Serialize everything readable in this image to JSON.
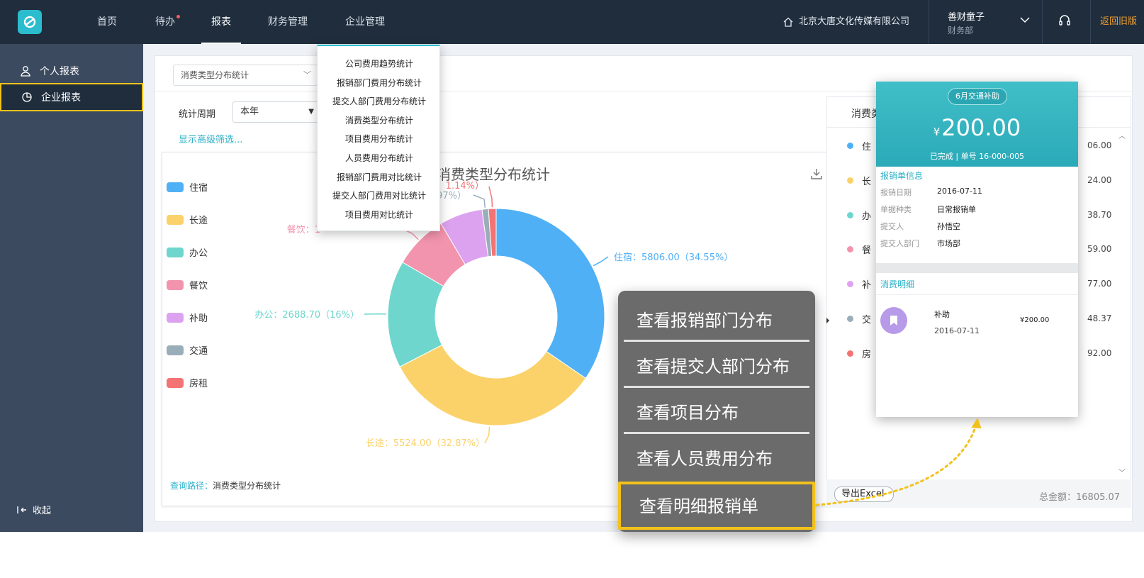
{
  "nav": {
    "items": [
      {
        "label": "首页"
      },
      {
        "label": "待办"
      },
      {
        "label": "报表"
      },
      {
        "label": "财务管理"
      },
      {
        "label": "企业管理"
      }
    ],
    "company": "北京大唐文化传媒有限公司",
    "user_name": "善财童子",
    "user_dept": "财务部",
    "back_old": "返回旧版",
    "icons": [
      "logo-icon",
      "home-icon",
      "chevron-down-icon",
      "headset-icon"
    ]
  },
  "sidebar": {
    "items": [
      {
        "label": "个人报表",
        "icon": "user-icon"
      },
      {
        "label": "企业报表",
        "icon": "pie-icon"
      }
    ],
    "collapse": "收起"
  },
  "filters": {
    "report_select": "消费类型分布统计",
    "period_label": "统计周期",
    "period_value": "本年",
    "advanced": "显示高级筛选..."
  },
  "dropdown": {
    "items": [
      "公司费用趋势统计",
      "报销部门费用分布统计",
      "提交人部门费用分布统计",
      "消费类型分布统计",
      "项目费用分布统计",
      "人员费用分布统计",
      "报销部门费用对比统计",
      "提交人部门费用对比统计",
      "项目费用对比统计"
    ]
  },
  "chart_data": {
    "type": "pie",
    "title": "消费类型分布统计",
    "donut": true,
    "categories": [
      "住宿",
      "长途",
      "办公",
      "餐饮",
      "补助",
      "交通",
      "房租"
    ],
    "values": [
      5806.0,
      5524.0,
      2688.7,
      1359.0,
      1077.0,
      158.37,
      192.0
    ],
    "percent_labels": [
      "34.55%",
      "32.87%",
      "16%",
      "",
      "",
      "",
      "1.14%"
    ],
    "colors": [
      "#4fb0f6",
      "#fbd26a",
      "#6ed6cc",
      "#f394ae",
      "#dda2ef",
      "#9aaeb9",
      "#f47374"
    ],
    "labels_visible": {
      "zhusu": "住宿：5806.00（34.55%）",
      "changtu": "长途：5524.00（32.87%）",
      "bangong": "办公：2688.70（16%）",
      "canyin_partial": "餐饮：1",
      "bu_partial": "97%）",
      "fangzu_partial": "1.14%）"
    },
    "legend_placement": "left"
  },
  "query_path": {
    "label": "查询路径：",
    "value": "消费类型分布统计"
  },
  "right_panel": {
    "header": "消费类",
    "rows": [
      {
        "label": "住",
        "amount": "06.00",
        "color": "#4fb0f6"
      },
      {
        "label": "长",
        "amount": "24.00",
        "color": "#fbd26a"
      },
      {
        "label": "办",
        "amount": "38.70",
        "color": "#6ed6cc"
      },
      {
        "label": "餐",
        "amount": "59.00",
        "color": "#f394ae"
      },
      {
        "label": "补",
        "amount": "77.00",
        "color": "#dda2ef"
      },
      {
        "label": "交",
        "amount": "48.37",
        "color": "#9aaeb9"
      },
      {
        "label": "房",
        "amount": "92.00",
        "color": "#f47374"
      }
    ],
    "export": "导出Excel",
    "total": "总金额：16805.07"
  },
  "detail_card": {
    "pill": "6月交通补助",
    "currency": "¥",
    "amount": "200.00",
    "status": "已完成 | 单号 16-000-005",
    "section1": "报销单信息",
    "fields": [
      {
        "label": "报销日期",
        "value": "2016-07-11"
      },
      {
        "label": "单据种类",
        "value": "日常报销单"
      },
      {
        "label": "提交人",
        "value": "孙悟空"
      },
      {
        "label": "提交人部门",
        "value": "市场部"
      }
    ],
    "section2": "消费明细",
    "item_name": "补助",
    "item_date": "2016-07-11",
    "item_amount": "¥200.00"
  },
  "context_menu": {
    "items": [
      "查看报销部门分布",
      "查看提交人部门分布",
      "查看项目分布",
      "查看人员费用分布",
      "查看明细报销单"
    ]
  },
  "highlight_color": "#f2c21b",
  "brand_color": "#2bbccd"
}
